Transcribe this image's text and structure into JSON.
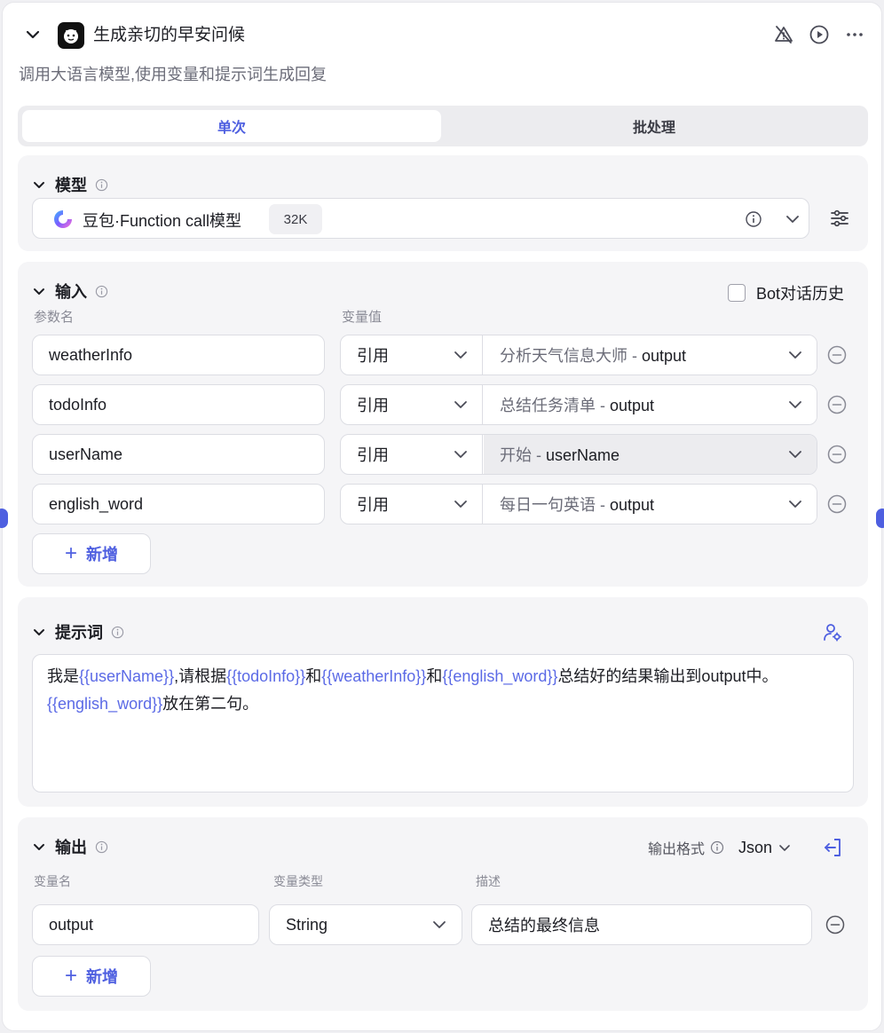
{
  "header": {
    "title": "生成亲切的早安问候",
    "description": "调用大语言模型,使用变量和提示词生成回复"
  },
  "tabs": [
    {
      "label": "单次",
      "active": true
    },
    {
      "label": "批处理",
      "active": false
    }
  ],
  "model": {
    "section_title": "模型",
    "name": "豆包·Function call模型",
    "badge": "32K"
  },
  "input": {
    "section_title": "输入",
    "history_label": "Bot对话历史",
    "history_checked": false,
    "col_param": "参数名",
    "col_value": "变量值",
    "rows": [
      {
        "param": "weatherInfo",
        "type": "引用",
        "source": "分析天气信息大师",
        "sep": " - ",
        "field": "output"
      },
      {
        "param": "todoInfo",
        "type": "引用",
        "source": "总结任务清单",
        "sep": " - ",
        "field": "output"
      },
      {
        "param": "userName",
        "type": "引用",
        "source": "开始",
        "sep": " - ",
        "field": "userName"
      },
      {
        "param": "english_word",
        "type": "引用",
        "source": "每日一句英语",
        "sep": " - ",
        "field": "output"
      }
    ],
    "add_label": "新增"
  },
  "prompt": {
    "section_title": "提示词",
    "parts": [
      {
        "t": "我是",
        "v": false
      },
      {
        "t": "{{userName}}",
        "v": true
      },
      {
        "t": ",请根据",
        "v": false
      },
      {
        "t": "{{todoInfo}}",
        "v": true
      },
      {
        "t": "和",
        "v": false
      },
      {
        "t": "{{weatherInfo}}",
        "v": true
      },
      {
        "t": "和",
        "v": false
      },
      {
        "t": "{{english_word}}",
        "v": true
      },
      {
        "t": "总结好的结果输出到output中。",
        "v": false
      },
      {
        "t": "{{english_word}}",
        "v": true
      },
      {
        "t": "放在第二句。",
        "v": false
      }
    ]
  },
  "output": {
    "section_title": "输出",
    "format_label": "输出格式",
    "format_value": "Json",
    "col_name": "变量名",
    "col_type": "变量类型",
    "col_desc": "描述",
    "rows": [
      {
        "name": "output",
        "type": "String",
        "desc": "总结的最终信息"
      }
    ],
    "add_label": "新增"
  },
  "colors": {
    "accent": "#4e5fe0",
    "variable": "#5b6ae6"
  }
}
